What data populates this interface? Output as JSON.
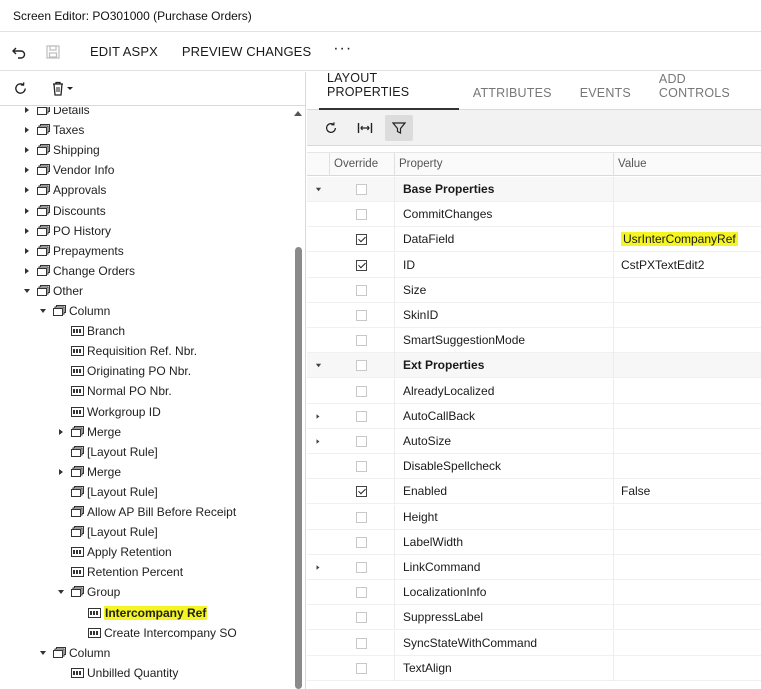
{
  "window": {
    "title": "Screen Editor: PO301000 (Purchase Orders)"
  },
  "toolbar": {
    "edit_aspx": "EDIT ASPX",
    "preview_changes": "PREVIEW CHANGES",
    "more": "···"
  },
  "tree": {
    "nodes": [
      {
        "label": "Details",
        "level": 1,
        "caret": "right",
        "icon": "group-icon",
        "highlight": false
      },
      {
        "label": "Taxes",
        "level": 1,
        "caret": "right",
        "icon": "group-icon",
        "highlight": false
      },
      {
        "label": "Shipping",
        "level": 1,
        "caret": "right",
        "icon": "group-icon",
        "highlight": false
      },
      {
        "label": "Vendor Info",
        "level": 1,
        "caret": "right",
        "icon": "group-icon",
        "highlight": false
      },
      {
        "label": "Approvals",
        "level": 1,
        "caret": "right",
        "icon": "group-icon",
        "highlight": false
      },
      {
        "label": "Discounts",
        "level": 1,
        "caret": "right",
        "icon": "group-icon",
        "highlight": false
      },
      {
        "label": "PO History",
        "level": 1,
        "caret": "right",
        "icon": "group-icon",
        "highlight": false
      },
      {
        "label": "Prepayments",
        "level": 1,
        "caret": "right",
        "icon": "group-icon",
        "highlight": false
      },
      {
        "label": "Change Orders",
        "level": 1,
        "caret": "right",
        "icon": "group-icon",
        "highlight": false
      },
      {
        "label": "Other",
        "level": 1,
        "caret": "down",
        "icon": "group-icon",
        "highlight": false
      },
      {
        "label": "Column",
        "level": 2,
        "caret": "down",
        "icon": "group-icon",
        "highlight": false
      },
      {
        "label": "Branch",
        "level": 3,
        "caret": "none",
        "icon": "field-icon",
        "highlight": false
      },
      {
        "label": "Requisition Ref. Nbr.",
        "level": 3,
        "caret": "none",
        "icon": "field-icon",
        "highlight": false
      },
      {
        "label": "Originating PO Nbr.",
        "level": 3,
        "caret": "none",
        "icon": "field-icon",
        "highlight": false
      },
      {
        "label": "Normal PO Nbr.",
        "level": 3,
        "caret": "none",
        "icon": "field-icon",
        "highlight": false
      },
      {
        "label": "Workgroup ID",
        "level": 3,
        "caret": "none",
        "icon": "field-icon",
        "highlight": false
      },
      {
        "label": "Merge",
        "level": 3,
        "caret": "right",
        "icon": "group-icon",
        "highlight": false
      },
      {
        "label": "[Layout Rule]",
        "level": 3,
        "caret": "none",
        "icon": "group-icon",
        "highlight": false
      },
      {
        "label": "Merge",
        "level": 3,
        "caret": "right",
        "icon": "group-icon",
        "highlight": false
      },
      {
        "label": "[Layout Rule]",
        "level": 3,
        "caret": "none",
        "icon": "group-icon",
        "highlight": false
      },
      {
        "label": "Allow AP Bill Before Receipt",
        "level": 3,
        "caret": "none",
        "icon": "group-icon",
        "highlight": false
      },
      {
        "label": "[Layout Rule]",
        "level": 3,
        "caret": "none",
        "icon": "group-icon",
        "highlight": false
      },
      {
        "label": "Apply Retention",
        "level": 3,
        "caret": "none",
        "icon": "field-icon",
        "highlight": false
      },
      {
        "label": "Retention Percent",
        "level": 3,
        "caret": "none",
        "icon": "field-icon",
        "highlight": false
      },
      {
        "label": "Group",
        "level": 3,
        "caret": "down",
        "icon": "group-icon",
        "highlight": false
      },
      {
        "label": "Intercompany Ref",
        "level": 4,
        "caret": "none",
        "icon": "field-icon",
        "highlight": true
      },
      {
        "label": "Create Intercompany SO",
        "level": 4,
        "caret": "none",
        "icon": "field-icon",
        "highlight": false
      },
      {
        "label": "Column",
        "level": 2,
        "caret": "down",
        "icon": "group-icon",
        "highlight": false
      },
      {
        "label": "Unbilled Quantity",
        "level": 3,
        "caret": "none",
        "icon": "field-icon",
        "highlight": false
      }
    ]
  },
  "tabs": [
    {
      "label": "LAYOUT PROPERTIES",
      "active": true
    },
    {
      "label": "ATTRIBUTES",
      "active": false
    },
    {
      "label": "EVENTS",
      "active": false
    },
    {
      "label": "ADD CONTROLS",
      "active": false
    }
  ],
  "grid": {
    "columns": {
      "override": "Override",
      "property": "Property",
      "value": "Value"
    },
    "rows": [
      {
        "group": true,
        "expander": "down",
        "checked": false,
        "property": "Base Properties",
        "value": "",
        "highlight": false
      },
      {
        "group": false,
        "expander": "",
        "checked": false,
        "property": "CommitChanges",
        "value": "",
        "highlight": false
      },
      {
        "group": false,
        "expander": "",
        "checked": true,
        "property": "DataField",
        "value": "UsrInterCompanyRef",
        "highlight": true
      },
      {
        "group": false,
        "expander": "",
        "checked": true,
        "property": "ID",
        "value": "CstPXTextEdit2",
        "highlight": false
      },
      {
        "group": false,
        "expander": "",
        "checked": false,
        "property": "Size",
        "value": "",
        "highlight": false
      },
      {
        "group": false,
        "expander": "",
        "checked": false,
        "property": "SkinID",
        "value": "",
        "highlight": false
      },
      {
        "group": false,
        "expander": "",
        "checked": false,
        "property": "SmartSuggestionMode",
        "value": "",
        "highlight": false
      },
      {
        "group": true,
        "expander": "down",
        "checked": false,
        "property": "Ext Properties",
        "value": "",
        "highlight": false
      },
      {
        "group": false,
        "expander": "",
        "checked": false,
        "property": "AlreadyLocalized",
        "value": "",
        "highlight": false
      },
      {
        "group": false,
        "expander": "right",
        "checked": false,
        "property": "AutoCallBack",
        "value": "",
        "highlight": false
      },
      {
        "group": false,
        "expander": "right",
        "checked": false,
        "property": "AutoSize",
        "value": "",
        "highlight": false
      },
      {
        "group": false,
        "expander": "",
        "checked": false,
        "property": "DisableSpellcheck",
        "value": "",
        "highlight": false
      },
      {
        "group": false,
        "expander": "",
        "checked": true,
        "property": "Enabled",
        "value": "False",
        "highlight": false
      },
      {
        "group": false,
        "expander": "",
        "checked": false,
        "property": "Height",
        "value": "",
        "highlight": false
      },
      {
        "group": false,
        "expander": "",
        "checked": false,
        "property": "LabelWidth",
        "value": "",
        "highlight": false
      },
      {
        "group": false,
        "expander": "right",
        "checked": false,
        "property": "LinkCommand",
        "value": "",
        "highlight": false
      },
      {
        "group": false,
        "expander": "",
        "checked": false,
        "property": "LocalizationInfo",
        "value": "",
        "highlight": false
      },
      {
        "group": false,
        "expander": "",
        "checked": false,
        "property": "SuppressLabel",
        "value": "",
        "highlight": false
      },
      {
        "group": false,
        "expander": "",
        "checked": false,
        "property": "SyncStateWithCommand",
        "value": "",
        "highlight": false
      },
      {
        "group": false,
        "expander": "",
        "checked": false,
        "property": "TextAlign",
        "value": "",
        "highlight": false
      }
    ]
  },
  "colors": {
    "highlight": "#f5f524",
    "active_tab_border": "#333333"
  }
}
